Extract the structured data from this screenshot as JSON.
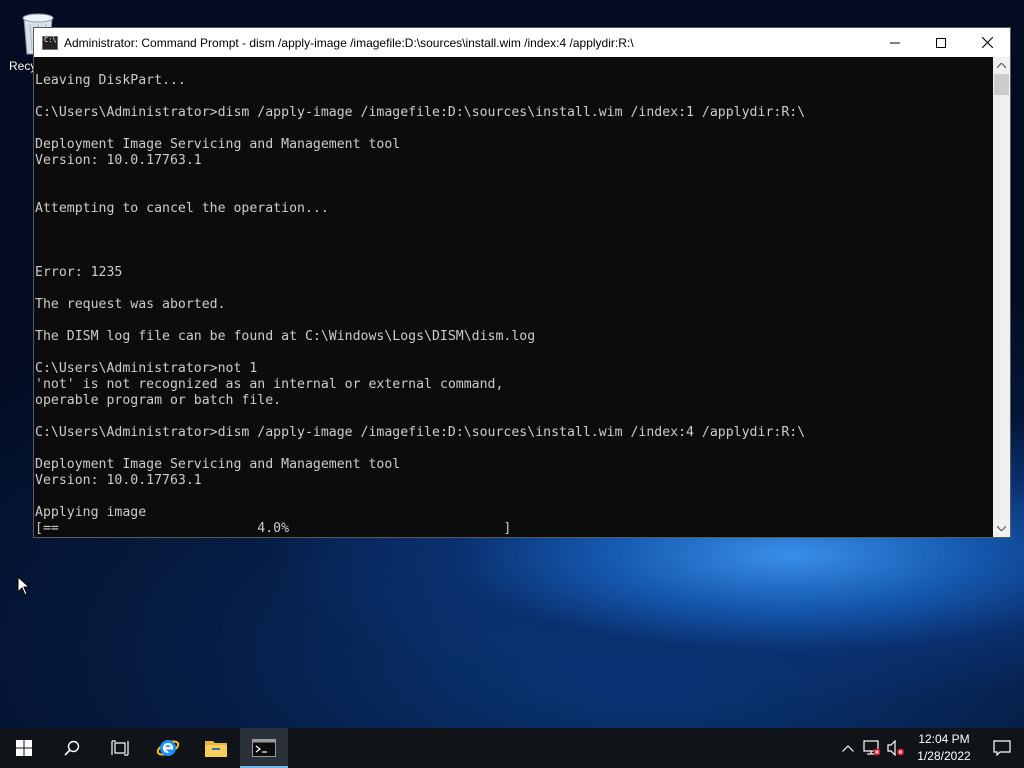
{
  "desktop": {
    "recycle_bin_label": "Recy"
  },
  "window": {
    "title": "Administrator: Command Prompt - dism  /apply-image /imagefile:D:\\sources\\install.wim /index:4 /applydir:R:\\",
    "console_text": "Leaving DiskPart...\n\nC:\\Users\\Administrator>dism /apply-image /imagefile:D:\\sources\\install.wim /index:1 /applydir:R:\\\n\nDeployment Image Servicing and Management tool\nVersion: 10.0.17763.1\n\n\nAttempting to cancel the operation...\n\n\n\nError: 1235\n\nThe request was aborted.\n\nThe DISM log file can be found at C:\\Windows\\Logs\\DISM\\dism.log\n\nC:\\Users\\Administrator>not 1\n'not' is not recognized as an internal or external command,\noperable program or batch file.\n\nC:\\Users\\Administrator>dism /apply-image /imagefile:D:\\sources\\install.wim /index:4 /applydir:R:\\\n\nDeployment Image Servicing and Management tool\nVersion: 10.0.17763.1\n\nApplying image\n[==                         4.0%                           ]",
    "progress_percent": 4.0,
    "buttons": [
      "minimize-icon",
      "maximize-icon",
      "close-icon"
    ]
  },
  "taskbar": {
    "pinned": [
      "windows-start-icon",
      "search-icon",
      "task-view-icon",
      "internet-explorer-icon",
      "file-explorer-icon",
      "command-prompt-icon"
    ],
    "tray_icons": [
      "chevron-up-icon",
      "network-icon",
      "volume-muted-icon"
    ],
    "clock": {
      "time": "12:04 PM",
      "date": "1/28/2022"
    }
  },
  "colors": {
    "console_bg": "#0c0c0c",
    "console_fg": "#cccccc",
    "taskbar_bg": "#101418",
    "active_indicator": "#76b9ed"
  }
}
